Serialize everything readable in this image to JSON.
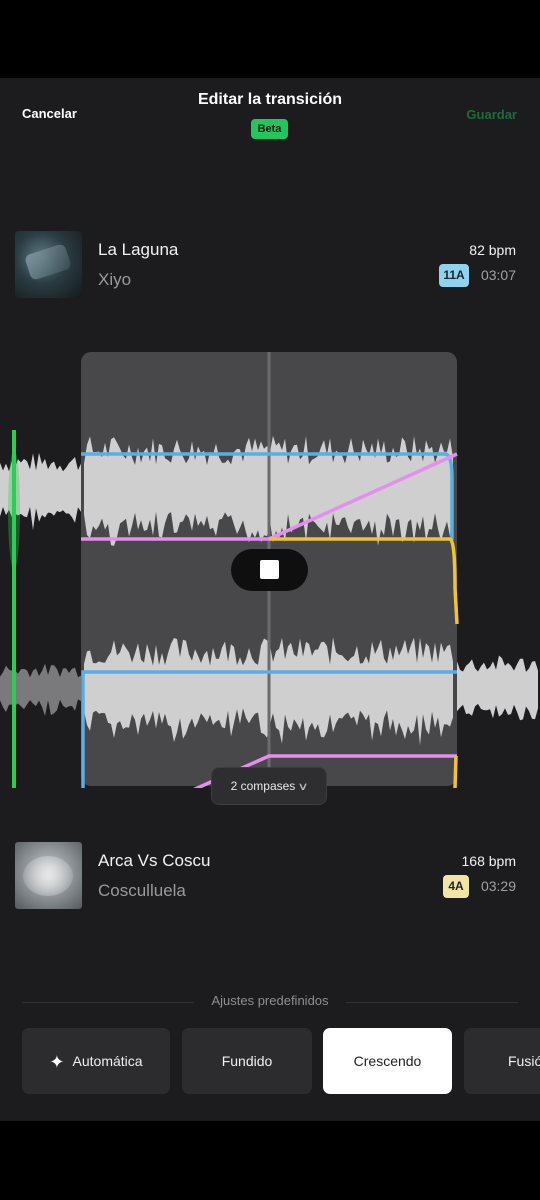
{
  "header": {
    "cancel_label": "Cancelar",
    "title": "Editar la transición",
    "badge": "Beta",
    "save_label": "Guardar"
  },
  "track_out": {
    "name": "La Laguna",
    "artist": "Xiyo",
    "bpm": "82 bpm",
    "key": "11A",
    "key_color": "#8fd3ee",
    "duration": "03:07"
  },
  "track_in": {
    "name": "Arca Vs Coscu",
    "artist": "Cosculluela",
    "bpm": "168 bpm",
    "key": "4A",
    "key_color": "#f2e3a6",
    "duration": "03:29"
  },
  "transition": {
    "length_label": "2 compases",
    "curve_colors": {
      "volume": "#5aaee6",
      "high": "#e58ef0",
      "low": "#f1c232"
    },
    "playhead_color": "#2ecc55"
  },
  "presets": {
    "label": "Ajustes predefinidos",
    "items": [
      {
        "label": "Automática",
        "icon": "sparkle-icon"
      },
      {
        "label": "Fundido"
      },
      {
        "label": "Crescendo",
        "selected": true
      },
      {
        "label": "Fusión"
      }
    ]
  }
}
